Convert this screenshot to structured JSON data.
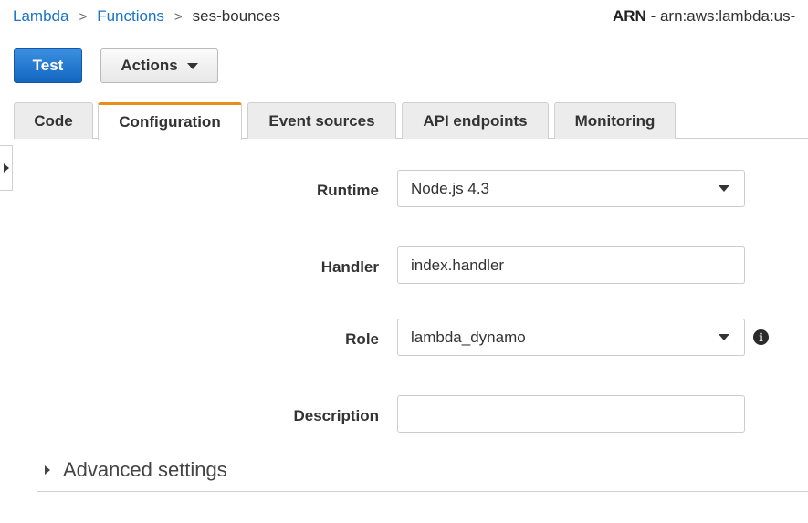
{
  "breadcrumb": {
    "items": [
      "Lambda",
      "Functions",
      "ses-bounces"
    ],
    "separator": ">"
  },
  "arn": {
    "label": "ARN",
    "value": " - arn:aws:lambda:us-"
  },
  "toolbar": {
    "test_label": "Test",
    "actions_label": "Actions"
  },
  "tabs": [
    {
      "label": "Code",
      "active": false
    },
    {
      "label": "Configuration",
      "active": true
    },
    {
      "label": "Event sources",
      "active": false
    },
    {
      "label": "API endpoints",
      "active": false
    },
    {
      "label": "Monitoring",
      "active": false
    }
  ],
  "form": {
    "runtime": {
      "label": "Runtime",
      "value": "Node.js 4.3"
    },
    "handler": {
      "label": "Handler",
      "value": "index.handler"
    },
    "role": {
      "label": "Role",
      "value": "lambda_dynamo",
      "info": "i"
    },
    "description": {
      "label": "Description",
      "value": ""
    }
  },
  "advanced": {
    "label": "Advanced settings"
  },
  "colors": {
    "primary_button": "#1466c0",
    "active_tab_accent": "#e88f1a",
    "link": "#1a73c9"
  },
  "icons": {
    "breadcrumb_separator": "chevron-right-icon",
    "actions_caret": "caret-down-icon",
    "sidebar_toggle": "triangle-right-icon",
    "role_info": "info-icon",
    "advanced_toggle": "triangle-right-icon"
  }
}
